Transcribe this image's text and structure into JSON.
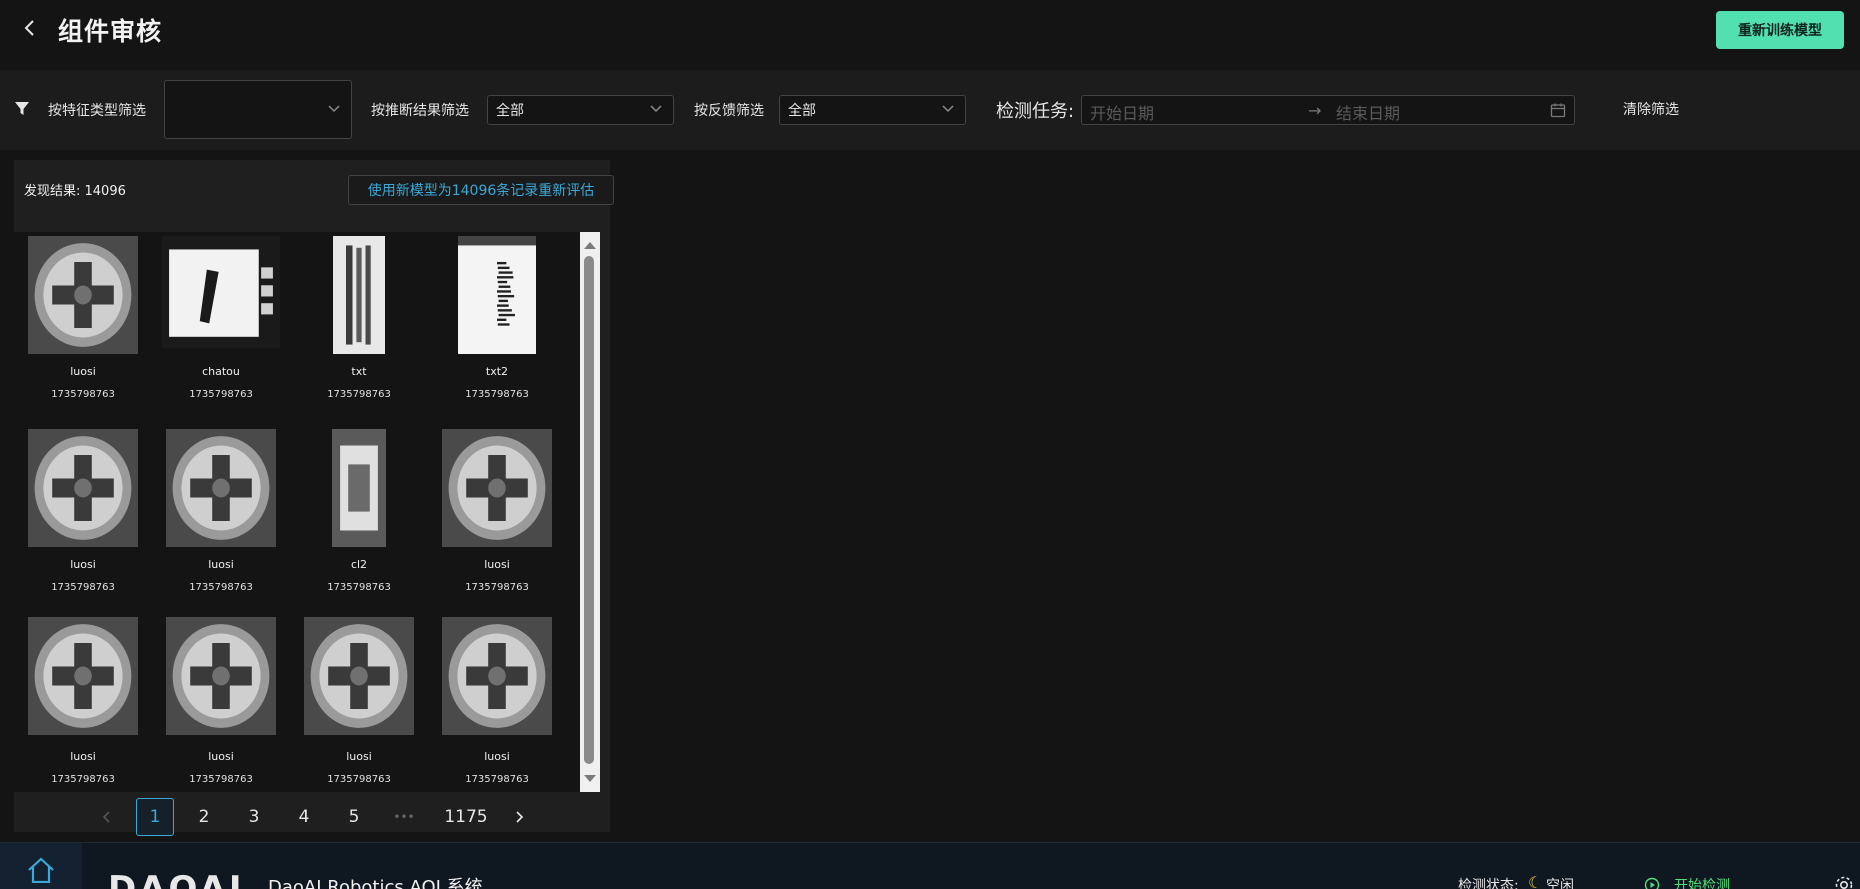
{
  "header": {
    "title": "组件审核",
    "retrain_label": "重新训练模型"
  },
  "filters": {
    "feature_type_label": "按特征类型筛选",
    "feature_type_value": "",
    "inference_label": "按推断结果筛选",
    "inference_value": "全部",
    "feedback_label": "按反馈筛选",
    "feedback_value": "全部",
    "task_label": "检测任务:",
    "start_placeholder": "开始日期",
    "end_placeholder": "结束日期",
    "clear_label": "清除筛选"
  },
  "results": {
    "count_label": "发现结果: 14096",
    "reevaluate_label": "使用新模型为14096条记录重新评估"
  },
  "items": [
    {
      "name": "luosi",
      "time": "1735798763",
      "kind": "screw"
    },
    {
      "name": "chatou",
      "time": "1735798763",
      "kind": "plug"
    },
    {
      "name": "txt",
      "time": "1735798763",
      "kind": "text"
    },
    {
      "name": "txt2",
      "time": "1735798763",
      "kind": "barcode"
    },
    {
      "name": "luosi",
      "time": "1735798763",
      "kind": "screw"
    },
    {
      "name": "luosi",
      "time": "1735798763",
      "kind": "screw"
    },
    {
      "name": "cl2",
      "time": "1735798763",
      "kind": "chip"
    },
    {
      "name": "luosi",
      "time": "1735798763",
      "kind": "screw"
    },
    {
      "name": "luosi",
      "time": "1735798763",
      "kind": "screw"
    },
    {
      "name": "luosi",
      "time": "1735798763",
      "kind": "screw"
    },
    {
      "name": "luosi",
      "time": "1735798763",
      "kind": "screw"
    },
    {
      "name": "luosi",
      "time": "1735798763",
      "kind": "screw"
    }
  ],
  "pagination": {
    "pages": [
      "1",
      "2",
      "3",
      "4",
      "5"
    ],
    "ellipsis": "•••",
    "last": "1175",
    "current": "1"
  },
  "footer": {
    "logo": "DAOAI",
    "app_name": "DaoAI Robotics AOI 系统",
    "status_label": "检测状态:",
    "status_value": "空闲",
    "start_label": "开始检测"
  },
  "colors": {
    "accent": "#52e0b0",
    "link": "#3aa8d8",
    "start": "#52e07a"
  }
}
